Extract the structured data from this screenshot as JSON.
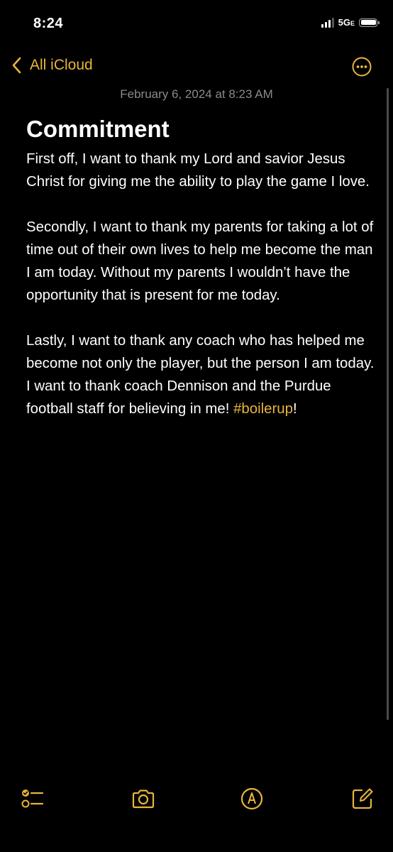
{
  "status_bar": {
    "time": "8:24",
    "network": "5G",
    "network_suffix": "E"
  },
  "nav": {
    "back_label": "All iCloud",
    "more_icon": "ellipsis-circle-icon",
    "accent_color": "#e8b53c"
  },
  "note": {
    "date": "February 6, 2024 at 8:23 AM",
    "title": "Commitment",
    "paragraphs": [
      "First off, I want to thank my Lord and savior Jesus Christ for giving me the ability to play the game I love.",
      "Secondly, I want to thank my parents for taking a lot of time out of their own lives to help me become the man I am today. Without my parents I wouldn’t have the opportunity that is present for me today.",
      "Lastly, I want to thank any coach who has helped me become not only the player, but the person I am today. I want to thank coach Dennison and the Purdue football staff for believing in me! "
    ],
    "hashtag": "#boilerup",
    "trailing": "!"
  },
  "toolbar": {
    "items": [
      "checklist-icon",
      "camera-icon",
      "markup-icon",
      "compose-icon"
    ]
  }
}
